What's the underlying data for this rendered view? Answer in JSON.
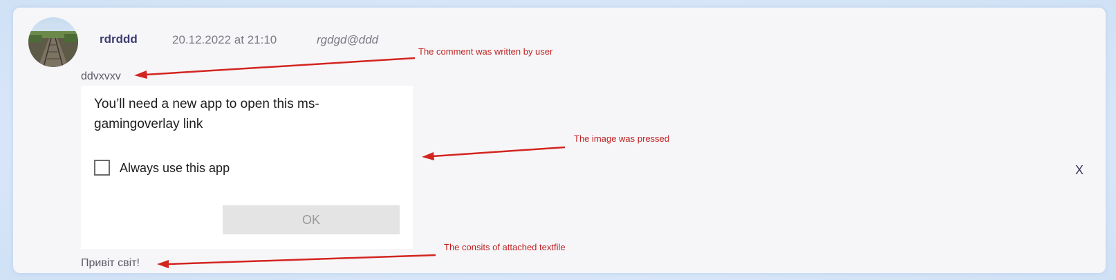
{
  "comment": {
    "username": "rdrddd",
    "date": "20.12.2022 at 21:10",
    "email": "rgdgd@ddd",
    "text": "ddvxvxv",
    "attached_file_text": "Привіт світ!",
    "close_label": "X"
  },
  "attached_image": {
    "dialog_title": "You’ll need a new app to open this ms-gamingoverlay link",
    "checkbox_label": "Always use this app",
    "ok_label": "OK"
  },
  "annotations": {
    "comment_note": "The comment was written by user",
    "image_note": "The image was pressed",
    "file_note": "The consits of attached textfile"
  },
  "colors": {
    "annotation": "#c0211f",
    "username": "#3e3c70",
    "card_background": "#f6f6f9"
  },
  "icons": {
    "avatar": "railway-photo-avatar",
    "close": "close-icon"
  }
}
